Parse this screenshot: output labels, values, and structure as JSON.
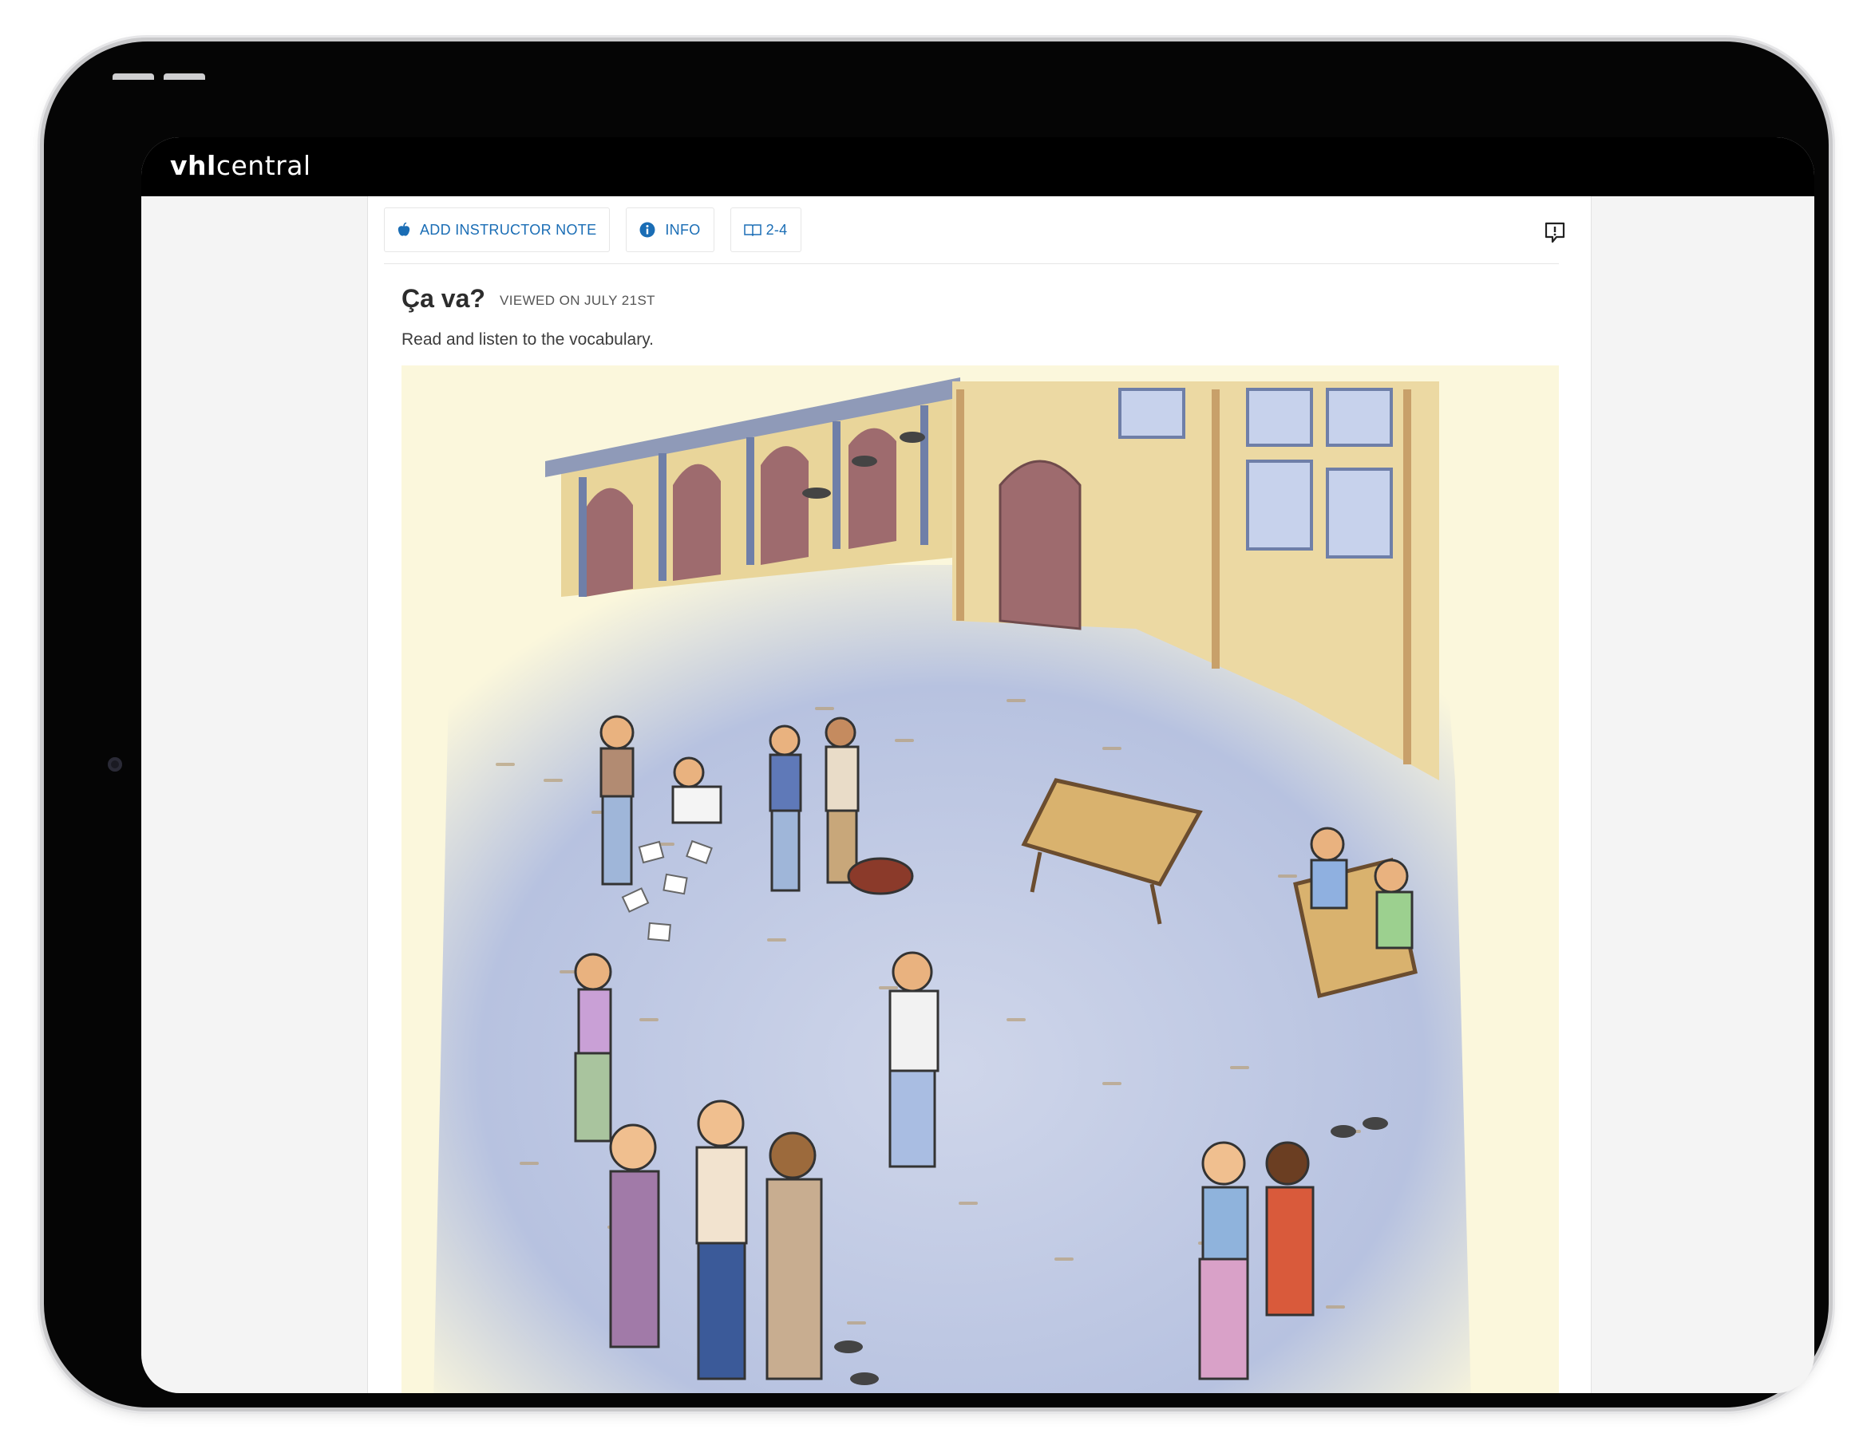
{
  "app": {
    "logo_bold": "vhl",
    "logo_light": "central"
  },
  "toolbar": {
    "instructor_note_label": "ADD INSTRUCTOR NOTE",
    "info_label": "INFO",
    "page_ref_label": "2-4"
  },
  "activity": {
    "title": "Ça va?",
    "viewed": "VIEWED ON JULY 21ST",
    "instructions": "Read and listen to the vocabulary."
  },
  "colors": {
    "accent": "#1a6db5",
    "topbar": "#000000",
    "illustration_bg": "#fbf7dc"
  },
  "icons": {
    "instructor_note": "apple-icon",
    "info": "info-icon",
    "page_ref": "book-icon",
    "feedback": "feedback-icon"
  }
}
